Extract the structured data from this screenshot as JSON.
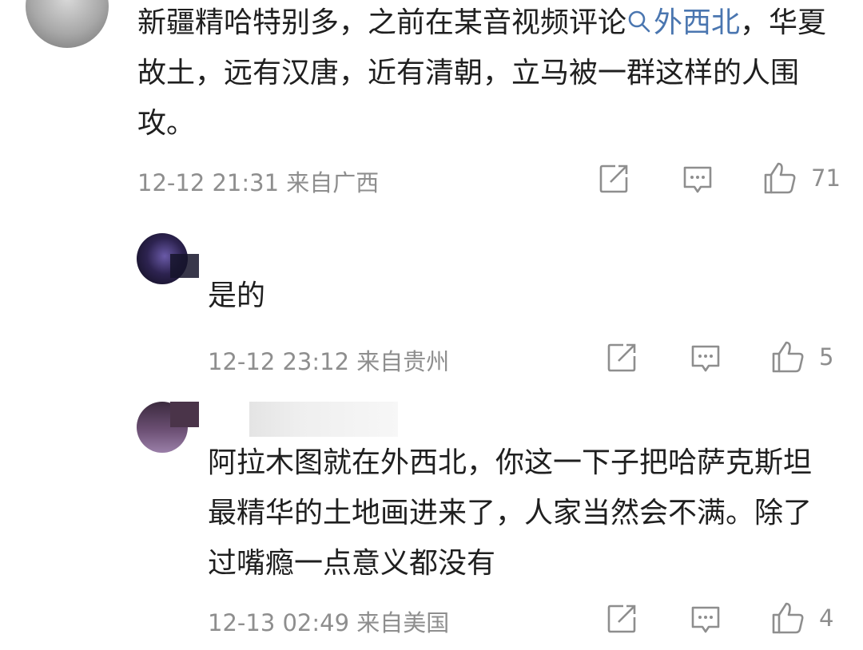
{
  "comments": [
    {
      "text_before": "新疆精哈特别多，之前在某音视频评论",
      "link_text": "外西北",
      "text_after": "，华夏故土，远有汉唐，近有清朝，立马被一群这样的人围攻。",
      "meta": "12-12 21:31 来自广西",
      "likes": "71"
    },
    {
      "text": "是的",
      "meta": "12-12 23:12 来自贵州",
      "likes": "5"
    },
    {
      "text": "阿拉木图就在外西北，你这一下子把哈萨克斯坦最精华的土地画进来了，人家当然会不满。除了过嘴瘾一点意义都没有",
      "meta": "12-13 02:49 来自美国",
      "likes": "4"
    }
  ],
  "icons": {
    "share": "share-icon",
    "comment": "comment-icon",
    "like": "thumbs-up-icon",
    "search": "search-icon"
  },
  "colors": {
    "link": "#4a76b0",
    "meta": "#8e8e8e",
    "text": "#1f1f1f"
  }
}
